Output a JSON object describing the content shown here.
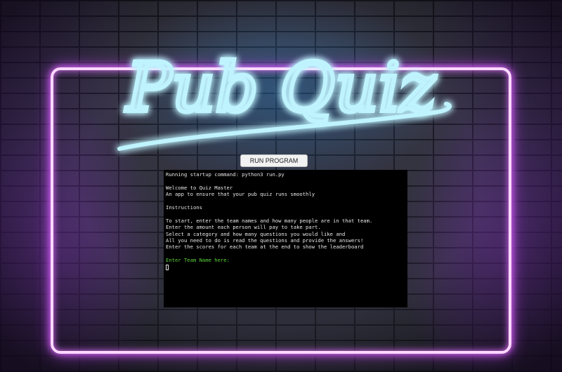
{
  "sign": {
    "text": "Pub Quiz"
  },
  "run_button": {
    "label": "RUN PROGRAM"
  },
  "terminal": {
    "lines": [
      "Running startup command: python3 run.py",
      "",
      "Welcome to Quiz Master",
      "An app to ensure that your pub quiz runs smoothly",
      "",
      "Instructions",
      "",
      "To start, enter the team names and how many people are in that team.",
      "Enter the amount each person will pay to take part.",
      "Select a category and how many questions you would like and",
      "All you need to do is read the questions and provide the answers!",
      "Enter the scores for each team at the end to show the leaderboard",
      ""
    ],
    "prompt": "Enter Team Name here:"
  },
  "colors": {
    "neon_blue": "#bff4ff",
    "neon_pink": "#ffd8ff",
    "prompt_green": "#5ad33a",
    "terminal_bg": "#000000"
  }
}
